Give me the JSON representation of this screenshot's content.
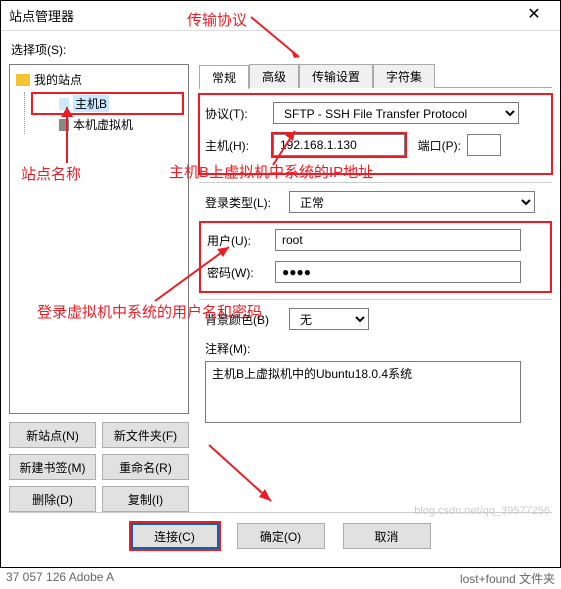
{
  "window": {
    "title": "站点管理器"
  },
  "select_label": "选择项(S):",
  "tree": {
    "root": "我的站点",
    "items": [
      "主机B",
      "本机虚拟机"
    ]
  },
  "buttons": {
    "new_site": "新站点(N)",
    "new_folder": "新文件夹(F)",
    "new_bookmark": "新建书签(M)",
    "rename": "重命名(R)",
    "delete": "删除(D)",
    "copy": "复制(I)"
  },
  "tabs": [
    "常规",
    "高级",
    "传输设置",
    "字符集"
  ],
  "form": {
    "protocol_label": "协议(T):",
    "protocol_value": "SFTP - SSH File Transfer Protocol",
    "host_label": "主机(H):",
    "host_value": "192.168.1.130",
    "port_label": "端口(P):",
    "port_value": "",
    "login_type_label": "登录类型(L):",
    "login_type_value": "正常",
    "user_label": "用户(U):",
    "user_value": "root",
    "pass_label": "密码(W):",
    "pass_value": "●●●●",
    "bgcolor_label": "背景颜色(B)",
    "bgcolor_value": "无",
    "comment_label": "注释(M):",
    "comment_value": "主机B上虚拟机中的Ubuntu18.0.4系统"
  },
  "footer": {
    "connect": "连接(C)",
    "ok": "确定(O)",
    "cancel": "取消"
  },
  "annotations": {
    "a1": "传输协议",
    "a2": "站点名称",
    "a3": "主机B上虚拟机中系统的IP地址",
    "a4": "登录虚拟机中系统的用户名和密码"
  },
  "cutoff_text": "37 057 126  Adobe A",
  "cutoff_right": "lost+found  文件夹"
}
